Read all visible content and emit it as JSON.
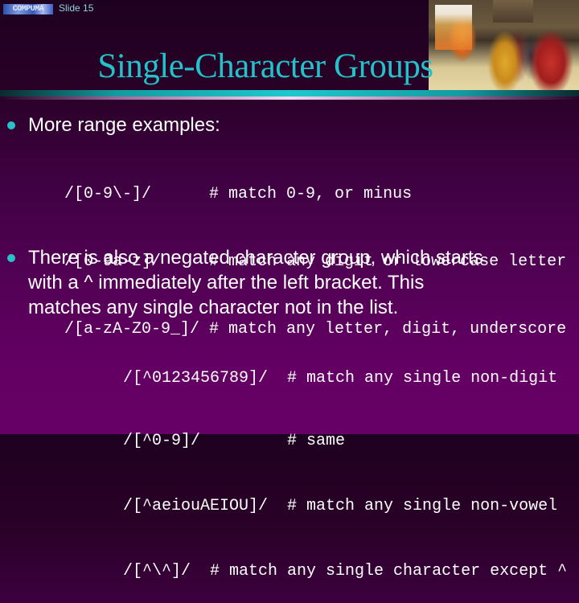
{
  "header": {
    "logo_text": "COMPUMA",
    "slide_label": "Slide 15"
  },
  "photo": {
    "icon": "ballroom-dancers-photo"
  },
  "title": "Single-Character Groups",
  "bullets": [
    {
      "text": "More range examples:",
      "code_lines": [
        "/[0-9\\-]/      # match 0-9, or minus",
        "/[0-9a-z]/     # match any digit or lowercase letter",
        "/[a-zA-Z0-9_]/ # match any letter, digit, underscore"
      ]
    },
    {
      "text_lines": [
        "There is also a negated character group, which starts",
        "with a ^ immediately after the left bracket. This",
        "matches any single character not in the list."
      ],
      "code_lines": [
        "/[^0123456789]/  # match any single non-digit",
        "/[^0-9]/         # same",
        "/[^aeiouAEIOU]/  # match any single non-vowel",
        "/[^\\^]/  # match any single character except ^"
      ]
    }
  ],
  "colors": {
    "title": "#25c1c8",
    "bullet": "#29c0c8",
    "background_top": "#2a0128",
    "background_bottom": "#660066",
    "text": "#ffffff"
  }
}
